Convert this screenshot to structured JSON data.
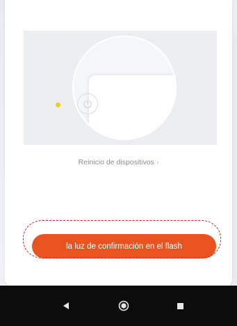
{
  "card": {
    "top_text": ""
  },
  "illustration": {
    "image_label": "device-reset-illustration"
  },
  "reset_link": {
    "label": "Reinicio de dispositivos",
    "chevron": "›"
  },
  "confirm_button": {
    "label": "la luz de confirmación en el flash",
    "color": "#e8531f"
  },
  "highlight": {
    "color": "#d1261b"
  },
  "navigation_bar": {
    "icons": [
      "back-icon",
      "home-icon",
      "recent-apps-icon"
    ]
  }
}
